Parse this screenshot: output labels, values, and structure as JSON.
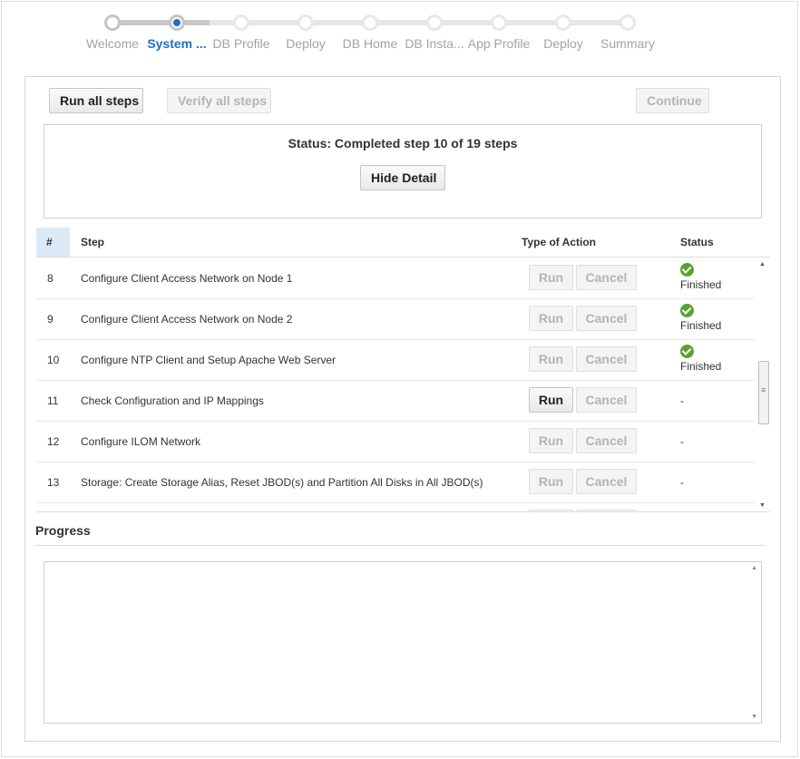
{
  "train": {
    "steps": [
      {
        "label": "Welcome",
        "state": "visited"
      },
      {
        "label": "System ...",
        "state": "current"
      },
      {
        "label": "DB Profile",
        "state": "pending"
      },
      {
        "label": "Deploy",
        "state": "pending"
      },
      {
        "label": "DB Home",
        "state": "pending"
      },
      {
        "label": "DB Insta...",
        "state": "pending"
      },
      {
        "label": "App Profile",
        "state": "pending"
      },
      {
        "label": "Deploy",
        "state": "pending"
      },
      {
        "label": "Summary",
        "state": "pending"
      }
    ]
  },
  "toolbar": {
    "run_all": "Run all steps",
    "verify_all": "Verify all steps",
    "continue": "Continue"
  },
  "status": {
    "text": "Status: Completed step 10 of 19 steps",
    "hide_detail": "Hide Detail"
  },
  "table": {
    "headers": {
      "num": "#",
      "step": "Step",
      "action": "Type of Action",
      "status": "Status"
    },
    "run_label": "Run",
    "cancel_label": "Cancel",
    "rows": [
      {
        "num": "8",
        "step": "Configure Client Access Network on Node 1",
        "status": "Finished"
      },
      {
        "num": "9",
        "step": "Configure Client Access Network on Node 2",
        "status": "Finished"
      },
      {
        "num": "10",
        "step": "Configure NTP Client and Setup Apache Web Server",
        "status": "Finished"
      },
      {
        "num": "11",
        "step": "Check Configuration and IP Mappings",
        "status": "-"
      },
      {
        "num": "12",
        "step": "Configure ILOM Network",
        "status": "-"
      },
      {
        "num": "13",
        "step": "Storage: Create Storage Alias, Reset JBOD(s) and Partition All Disks in All JBOD(s)",
        "status": "-"
      }
    ]
  },
  "progress": {
    "title": "Progress",
    "log": ""
  },
  "colors": {
    "accent": "#1f6fc4",
    "success": "#5aa233",
    "header_selected": "#dbe9f7"
  }
}
